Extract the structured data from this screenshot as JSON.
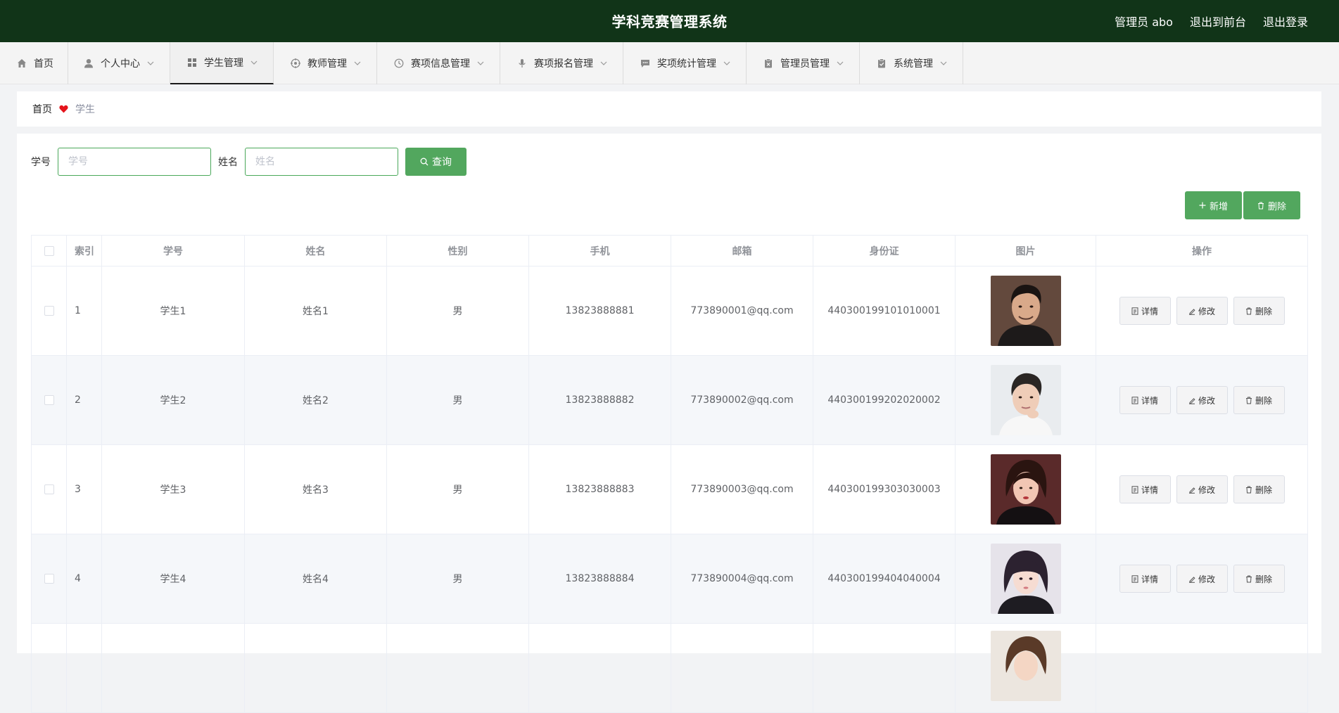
{
  "header": {
    "title": "学科竞赛管理系统",
    "user_label": "管理员 abo",
    "to_front_label": "退出到前台",
    "logout_label": "退出登录"
  },
  "nav": {
    "items": [
      {
        "label": "首页",
        "icon": "home-icon"
      },
      {
        "label": "个人中心",
        "icon": "user-icon"
      },
      {
        "label": "学生管理",
        "icon": "grid-icon",
        "active": true
      },
      {
        "label": "教师管理",
        "icon": "target-icon"
      },
      {
        "label": "赛项信息管理",
        "icon": "clock-icon"
      },
      {
        "label": "赛项报名管理",
        "icon": "microphone-icon"
      },
      {
        "label": "奖项统计管理",
        "icon": "chat-icon"
      },
      {
        "label": "管理员管理",
        "icon": "clipboard-x-icon"
      },
      {
        "label": "系统管理",
        "icon": "clipboard-check-icon"
      }
    ]
  },
  "breadcrumb": {
    "home": "首页",
    "current": "学生"
  },
  "search": {
    "student_no_label": "学号",
    "student_no_placeholder": "学号",
    "name_label": "姓名",
    "name_placeholder": "姓名",
    "query_label": "查询"
  },
  "actions": {
    "add_label": "新增",
    "delete_label": "删除"
  },
  "table": {
    "headers": [
      "索引",
      "学号",
      "姓名",
      "性别",
      "手机",
      "邮箱",
      "身份证",
      "图片",
      "操作"
    ],
    "op_labels": {
      "detail": "详情",
      "edit": "修改",
      "delete": "删除"
    },
    "rows": [
      {
        "index": "1",
        "no": "学生1",
        "name": "姓名1",
        "sex": "男",
        "phone": "13823888881",
        "email": "773890001@qq.com",
        "idcard": "440300199101010001"
      },
      {
        "index": "2",
        "no": "学生2",
        "name": "姓名2",
        "sex": "男",
        "phone": "13823888882",
        "email": "773890002@qq.com",
        "idcard": "440300199202020002"
      },
      {
        "index": "3",
        "no": "学生3",
        "name": "姓名3",
        "sex": "男",
        "phone": "13823888883",
        "email": "773890003@qq.com",
        "idcard": "440300199303030003"
      },
      {
        "index": "4",
        "no": "学生4",
        "name": "姓名4",
        "sex": "男",
        "phone": "13823888884",
        "email": "773890004@qq.com",
        "idcard": "440300199404040004"
      }
    ]
  },
  "colors": {
    "header_bg": "#113418",
    "accent_green": "#52a75e",
    "heart": "#e5141c"
  }
}
